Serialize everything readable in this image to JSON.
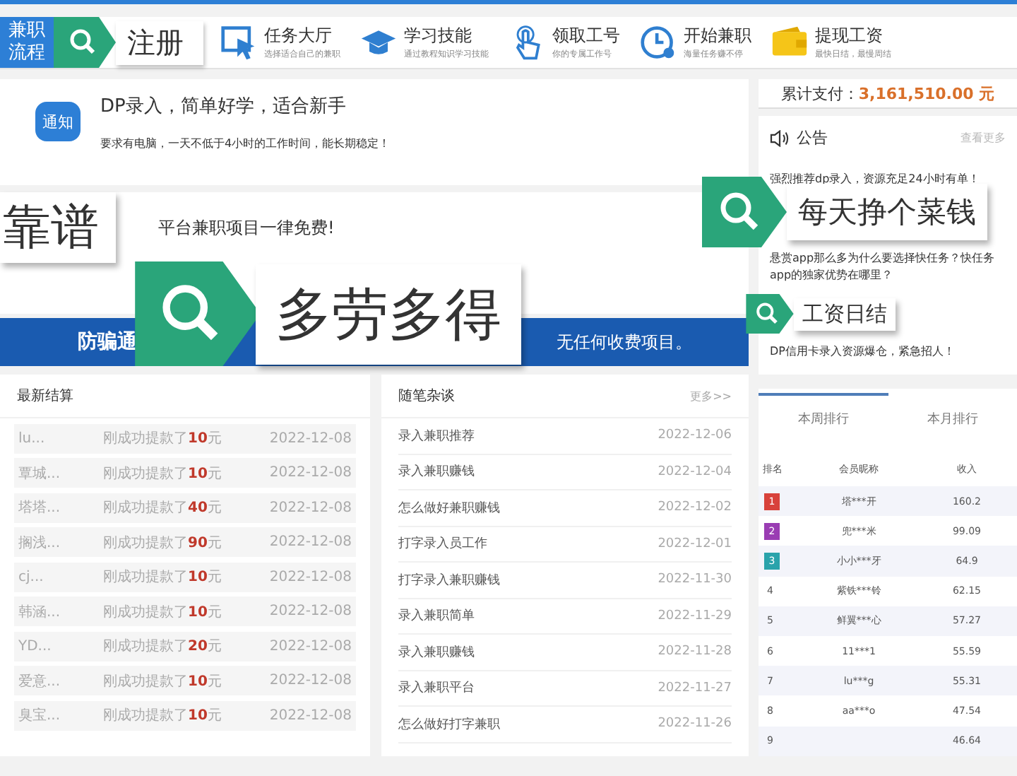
{
  "nav": {
    "process_label": "兼职流程",
    "register": "注册",
    "items": [
      {
        "title": "任务大厅",
        "subtitle": "选择适合自己的兼职"
      },
      {
        "title": "学习技能",
        "subtitle": "通过教程知识学习技能"
      },
      {
        "title": "领取工号",
        "subtitle": "你的专属工作号"
      },
      {
        "title": "开始兼职",
        "subtitle": "海量任务赚不停"
      },
      {
        "title": "提现工资",
        "subtitle": "最快日结，最慢周结"
      }
    ]
  },
  "notice": {
    "badge": "通知",
    "title": "DP录入，简单好学，适合新手",
    "text": "要求有电脑，一天不低于4小时的工作时间，能长期稳定！"
  },
  "notice2": {
    "title": "平台兼职项目一律免费!"
  },
  "banner": {
    "title": "防骗通",
    "text": "无任何收费项目。"
  },
  "stickers": [
    {
      "text": "靠谱",
      "tag": false
    },
    {
      "text": "多劳多得",
      "tag": true
    },
    {
      "text": "每天挣个菜钱",
      "tag": true
    },
    {
      "text": "工资日结",
      "tag": true
    }
  ],
  "settlements": {
    "title": "最新结算",
    "rows": [
      {
        "name": "lu...",
        "text": "刚成功提款了**10**元",
        "date": "2022-12-08"
      },
      {
        "name": "覃城...",
        "text": "刚成功提款了**10**元",
        "date": "2022-12-08"
      },
      {
        "name": "塔塔...",
        "text": "刚成功提款了**40**元",
        "date": "2022-12-08"
      },
      {
        "name": "搁浅...",
        "text": "刚成功提款了**90**元",
        "date": "2022-12-08"
      },
      {
        "name": "cj...",
        "text": "刚成功提款了**10**元",
        "date": "2022-12-08"
      },
      {
        "name": "韩涵...",
        "text": "刚成功提款了**10**元",
        "date": "2022-12-08"
      },
      {
        "name": "YD...",
        "text": "刚成功提款了**20**元",
        "date": "2022-12-08"
      },
      {
        "name": "爱意...",
        "text": "刚成功提款了**10**元",
        "date": "2022-12-08"
      },
      {
        "name": "臭宝...",
        "text": "刚成功提款了**10**元",
        "date": "2022-12-08"
      }
    ]
  },
  "articles": {
    "title": "随笔杂谈",
    "more": "更多>>",
    "rows": [
      {
        "title": "录入兼职推荐",
        "date": "2022-12-06"
      },
      {
        "title": "录入兼职赚钱",
        "date": "2022-12-04"
      },
      {
        "title": "怎么做好兼职赚钱",
        "date": "2022-12-02"
      },
      {
        "title": "打字录入员工作",
        "date": "2022-12-01"
      },
      {
        "title": "打字录入兼职赚钱",
        "date": "2022-11-30"
      },
      {
        "title": "录入兼职简单",
        "date": "2022-11-29"
      },
      {
        "title": "录入兼职赚钱",
        "date": "2022-11-28"
      },
      {
        "title": "录入兼职平台",
        "date": "2022-11-27"
      },
      {
        "title": "怎么做好打字兼职",
        "date": "2022-11-26"
      }
    ]
  },
  "total": {
    "label": "累计支付：",
    "value": "3,161,510.00 元"
  },
  "announcements": {
    "title": "公告",
    "more": "查看更多",
    "items": [
      "强烈推荐dp录入，资源充足24小时有单！",
      "悬赏app那么多为什么要选择快任务？快任务app的独家优势在哪里？",
      "DP信用卡录入资源爆仓，紧急招人！"
    ]
  },
  "ranking": {
    "tabs": [
      {
        "label": "本周排行",
        "selected": true
      },
      {
        "label": "本月排行",
        "selected": false
      }
    ],
    "columns": [
      "排名",
      "会员昵称",
      "收入"
    ],
    "rows": [
      {
        "kind": "medal",
        "color": "#d8423b",
        "rank": "1",
        "name": "塔***开",
        "income": "160.2"
      },
      {
        "kind": "medal",
        "color": "#9a3db3",
        "rank": "2",
        "name": "兜***米",
        "income": "99.09"
      },
      {
        "kind": "medal",
        "color": "#2aa3ab",
        "rank": "3",
        "name": "小小***牙",
        "income": "64.9"
      },
      {
        "kind": "plain",
        "rank": "4",
        "name": "紫铁***铃",
        "income": "62.15"
      },
      {
        "kind": "plain",
        "rank": "5",
        "name": "鲜翼***心",
        "income": "57.27"
      },
      {
        "kind": "plain",
        "rank": "6",
        "name": "11***1",
        "income": "55.59"
      },
      {
        "kind": "plain",
        "rank": "7",
        "name": "lu***g",
        "income": "55.31"
      },
      {
        "kind": "plain",
        "rank": "8",
        "name": "aa***o",
        "income": "47.54"
      },
      {
        "kind": "plain",
        "rank": "9",
        "income": "46.64"
      }
    ]
  }
}
